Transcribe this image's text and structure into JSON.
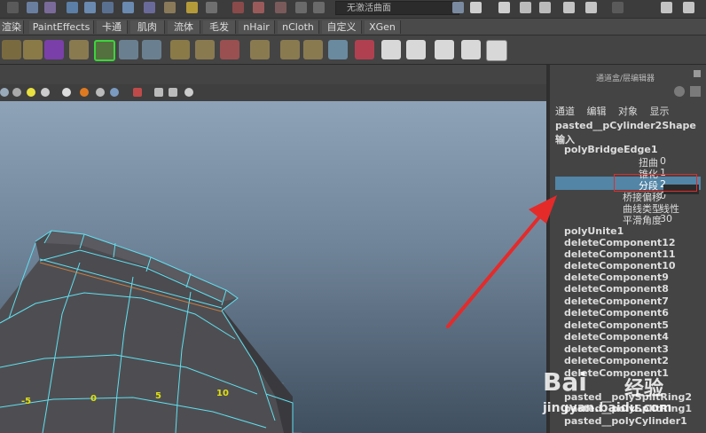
{
  "topbar": {
    "field_text": "无激活曲面"
  },
  "shelf_tabs": [
    "渲染",
    "PaintEffects",
    "卡通",
    "肌肉",
    "流体",
    "毛发",
    "nHair",
    "nCloth",
    "自定义",
    "XGen"
  ],
  "panel": {
    "title": "通道盒/层编辑器",
    "menu": [
      "通道",
      "编辑",
      "对象",
      "显示"
    ],
    "node_name": "pasted__pCylinder2Shape",
    "inputs_label": "输入",
    "bridge_node": "polyBridgeEdge1",
    "attrs": [
      {
        "label": "扭曲",
        "value": "0"
      },
      {
        "label": "锥化",
        "value": "1"
      },
      {
        "label": "分段",
        "value": "2"
      },
      {
        "label": "桥接偏移",
        "value": "0"
      },
      {
        "label": "曲线类型",
        "value": "线性"
      },
      {
        "label": "平滑角度",
        "value": "30"
      }
    ],
    "history": [
      "polyUnite1",
      "deleteComponent12",
      "deleteComponent11",
      "deleteComponent10",
      "deleteComponent9",
      "deleteComponent8",
      "deleteComponent7",
      "deleteComponent6",
      "deleteComponent5",
      "deleteComponent4",
      "deleteComponent3",
      "deleteComponent2",
      "deleteComponent1",
      "pasted__polySplitRing2",
      "pasted__polySplitRing1",
      "pasted__polyCylinder1"
    ]
  },
  "viewport": {
    "grid_labels": [
      "-5",
      "0",
      "5",
      "10"
    ]
  },
  "watermark": {
    "text1": "Bai",
    "text2": "经验",
    "url": "jingyan.baidu.com"
  },
  "colors": {
    "wire": "#5fe0f0",
    "annotation": "#e52a2a",
    "highlight": "#5285a6"
  }
}
